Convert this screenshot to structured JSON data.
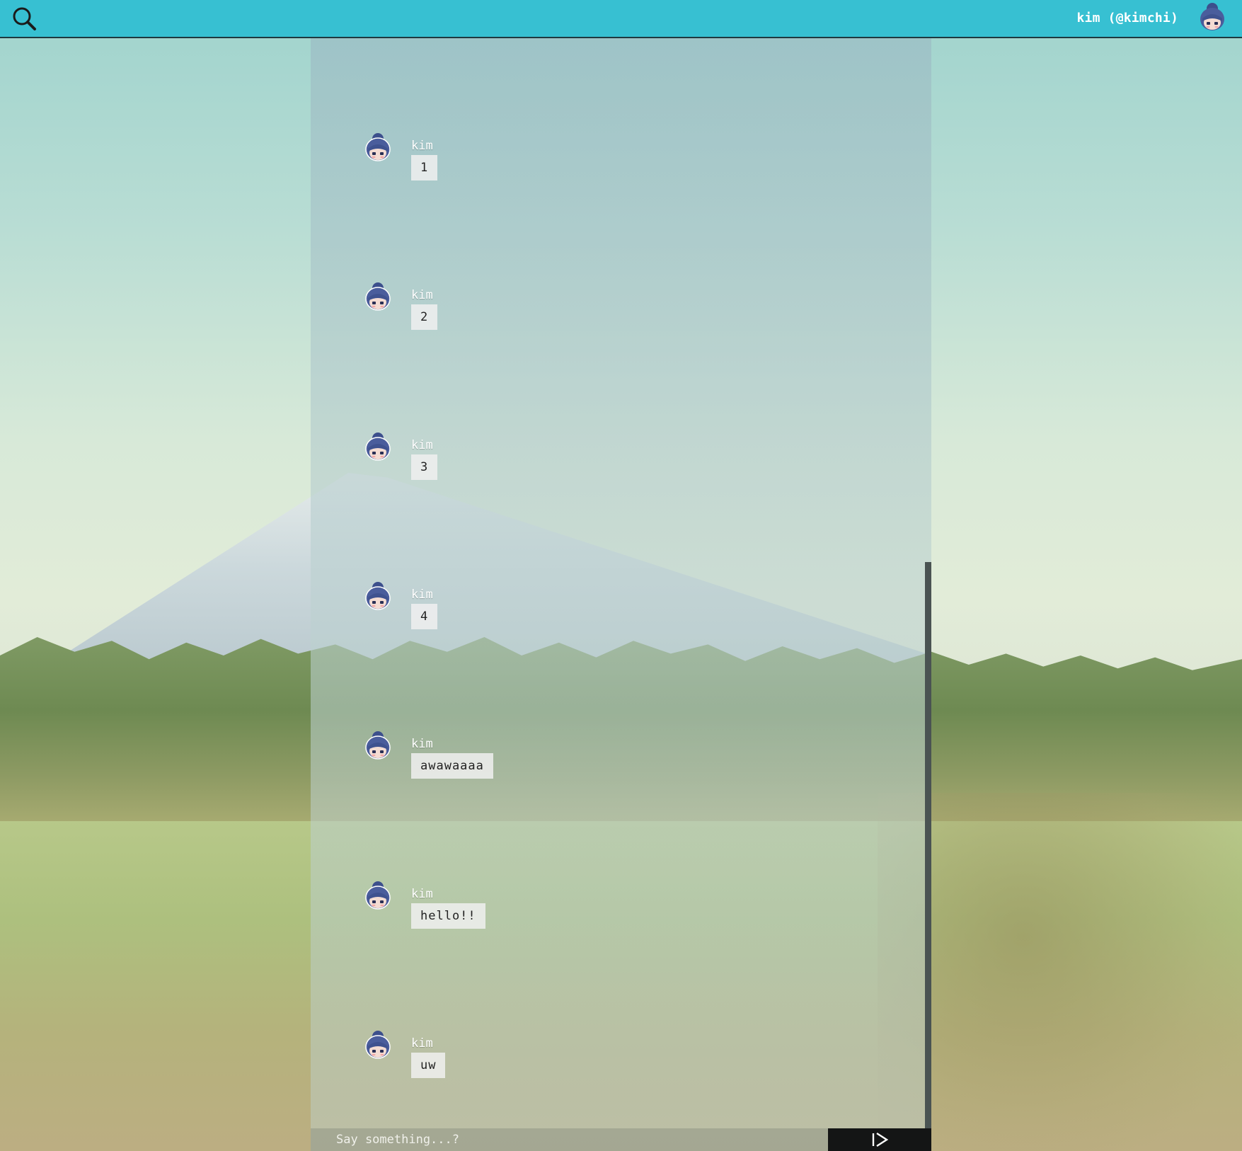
{
  "header": {
    "user_label": "kim (@kimchi)",
    "icons": {
      "search": "search-icon",
      "avatar": "user-avatar-icon"
    }
  },
  "messages": [
    {
      "author": "kim",
      "text": "1"
    },
    {
      "author": "kim",
      "text": "2"
    },
    {
      "author": "kim",
      "text": "3"
    },
    {
      "author": "kim",
      "text": "4"
    },
    {
      "author": "kim",
      "text": "awawaaaa"
    },
    {
      "author": "kim",
      "text": "hello!!"
    },
    {
      "author": "kim",
      "text": "uw"
    }
  ],
  "composer": {
    "placeholder": "Say something...?",
    "send_icon": "send-icon"
  },
  "colors": {
    "header_bg": "#37c0d2",
    "send_bg": "#141515"
  }
}
